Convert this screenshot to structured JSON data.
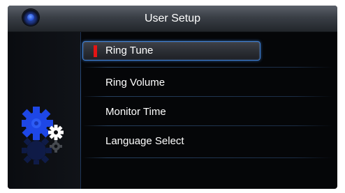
{
  "header": {
    "title": "User Setup",
    "home_icon": "home-button-icon"
  },
  "sidebar": {
    "icon": "settings-gears-icon"
  },
  "menu": {
    "items": [
      {
        "label": "Ring Tune",
        "selected": true
      },
      {
        "label": "Ring Volume",
        "selected": false
      },
      {
        "label": "Monitor Time",
        "selected": false
      },
      {
        "label": "Language Select",
        "selected": false
      }
    ]
  },
  "colors": {
    "accent": "#3d7fd6",
    "selection_marker": "#e41414",
    "gear_blue": "#1e47e6"
  }
}
